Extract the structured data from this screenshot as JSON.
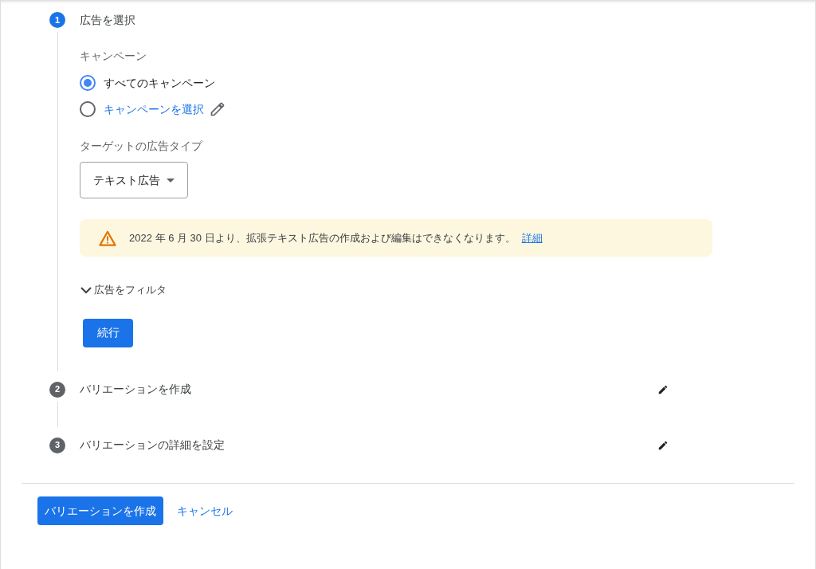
{
  "steps": [
    {
      "number": "1",
      "title": "広告を選択",
      "active": true,
      "editable": false
    },
    {
      "number": "2",
      "title": "バリエーションを作成",
      "active": false,
      "editable": true
    },
    {
      "number": "3",
      "title": "バリエーションの詳細を設定",
      "active": false,
      "editable": true
    }
  ],
  "select_ads": {
    "campaign_label": "キャンペーン",
    "campaign_options": [
      {
        "label": "すべてのキャンペーン",
        "selected": true,
        "kind": "plain"
      },
      {
        "label": "キャンペーンを選択",
        "selected": false,
        "kind": "link"
      }
    ],
    "ad_type_label": "ターゲットの広告タイプ",
    "ad_type_dropdown": {
      "value": "テキスト広告"
    },
    "warning": {
      "text": "2022 年 6 月 30 日より、拡張テキスト広告の作成および編集はできなくなります。",
      "link": "詳細"
    },
    "filter_toggle": "広告をフィルタ",
    "continue_button": "続行"
  },
  "footer": {
    "primary_button": "バリエーションを作成",
    "cancel_link": "キャンセル"
  }
}
